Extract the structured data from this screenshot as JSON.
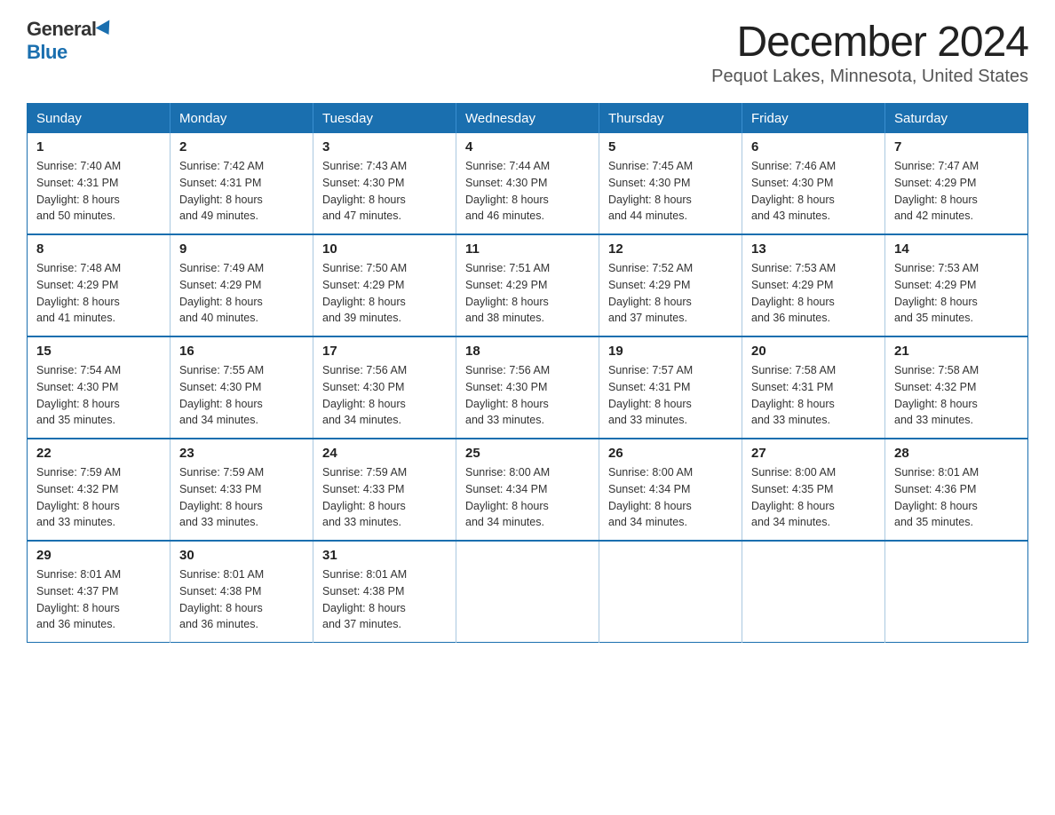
{
  "logo": {
    "general": "General",
    "blue": "Blue"
  },
  "title": "December 2024",
  "subtitle": "Pequot Lakes, Minnesota, United States",
  "days_of_week": [
    "Sunday",
    "Monday",
    "Tuesday",
    "Wednesday",
    "Thursday",
    "Friday",
    "Saturday"
  ],
  "weeks": [
    [
      {
        "day": "1",
        "sunrise": "7:40 AM",
        "sunset": "4:31 PM",
        "daylight": "8 hours and 50 minutes."
      },
      {
        "day": "2",
        "sunrise": "7:42 AM",
        "sunset": "4:31 PM",
        "daylight": "8 hours and 49 minutes."
      },
      {
        "day": "3",
        "sunrise": "7:43 AM",
        "sunset": "4:30 PM",
        "daylight": "8 hours and 47 minutes."
      },
      {
        "day": "4",
        "sunrise": "7:44 AM",
        "sunset": "4:30 PM",
        "daylight": "8 hours and 46 minutes."
      },
      {
        "day": "5",
        "sunrise": "7:45 AM",
        "sunset": "4:30 PM",
        "daylight": "8 hours and 44 minutes."
      },
      {
        "day": "6",
        "sunrise": "7:46 AM",
        "sunset": "4:30 PM",
        "daylight": "8 hours and 43 minutes."
      },
      {
        "day": "7",
        "sunrise": "7:47 AM",
        "sunset": "4:29 PM",
        "daylight": "8 hours and 42 minutes."
      }
    ],
    [
      {
        "day": "8",
        "sunrise": "7:48 AM",
        "sunset": "4:29 PM",
        "daylight": "8 hours and 41 minutes."
      },
      {
        "day": "9",
        "sunrise": "7:49 AM",
        "sunset": "4:29 PM",
        "daylight": "8 hours and 40 minutes."
      },
      {
        "day": "10",
        "sunrise": "7:50 AM",
        "sunset": "4:29 PM",
        "daylight": "8 hours and 39 minutes."
      },
      {
        "day": "11",
        "sunrise": "7:51 AM",
        "sunset": "4:29 PM",
        "daylight": "8 hours and 38 minutes."
      },
      {
        "day": "12",
        "sunrise": "7:52 AM",
        "sunset": "4:29 PM",
        "daylight": "8 hours and 37 minutes."
      },
      {
        "day": "13",
        "sunrise": "7:53 AM",
        "sunset": "4:29 PM",
        "daylight": "8 hours and 36 minutes."
      },
      {
        "day": "14",
        "sunrise": "7:53 AM",
        "sunset": "4:29 PM",
        "daylight": "8 hours and 35 minutes."
      }
    ],
    [
      {
        "day": "15",
        "sunrise": "7:54 AM",
        "sunset": "4:30 PM",
        "daylight": "8 hours and 35 minutes."
      },
      {
        "day": "16",
        "sunrise": "7:55 AM",
        "sunset": "4:30 PM",
        "daylight": "8 hours and 34 minutes."
      },
      {
        "day": "17",
        "sunrise": "7:56 AM",
        "sunset": "4:30 PM",
        "daylight": "8 hours and 34 minutes."
      },
      {
        "day": "18",
        "sunrise": "7:56 AM",
        "sunset": "4:30 PM",
        "daylight": "8 hours and 33 minutes."
      },
      {
        "day": "19",
        "sunrise": "7:57 AM",
        "sunset": "4:31 PM",
        "daylight": "8 hours and 33 minutes."
      },
      {
        "day": "20",
        "sunrise": "7:58 AM",
        "sunset": "4:31 PM",
        "daylight": "8 hours and 33 minutes."
      },
      {
        "day": "21",
        "sunrise": "7:58 AM",
        "sunset": "4:32 PM",
        "daylight": "8 hours and 33 minutes."
      }
    ],
    [
      {
        "day": "22",
        "sunrise": "7:59 AM",
        "sunset": "4:32 PM",
        "daylight": "8 hours and 33 minutes."
      },
      {
        "day": "23",
        "sunrise": "7:59 AM",
        "sunset": "4:33 PM",
        "daylight": "8 hours and 33 minutes."
      },
      {
        "day": "24",
        "sunrise": "7:59 AM",
        "sunset": "4:33 PM",
        "daylight": "8 hours and 33 minutes."
      },
      {
        "day": "25",
        "sunrise": "8:00 AM",
        "sunset": "4:34 PM",
        "daylight": "8 hours and 34 minutes."
      },
      {
        "day": "26",
        "sunrise": "8:00 AM",
        "sunset": "4:34 PM",
        "daylight": "8 hours and 34 minutes."
      },
      {
        "day": "27",
        "sunrise": "8:00 AM",
        "sunset": "4:35 PM",
        "daylight": "8 hours and 34 minutes."
      },
      {
        "day": "28",
        "sunrise": "8:01 AM",
        "sunset": "4:36 PM",
        "daylight": "8 hours and 35 minutes."
      }
    ],
    [
      {
        "day": "29",
        "sunrise": "8:01 AM",
        "sunset": "4:37 PM",
        "daylight": "8 hours and 36 minutes."
      },
      {
        "day": "30",
        "sunrise": "8:01 AM",
        "sunset": "4:38 PM",
        "daylight": "8 hours and 36 minutes."
      },
      {
        "day": "31",
        "sunrise": "8:01 AM",
        "sunset": "4:38 PM",
        "daylight": "8 hours and 37 minutes."
      },
      null,
      null,
      null,
      null
    ]
  ],
  "labels": {
    "sunrise": "Sunrise:",
    "sunset": "Sunset:",
    "daylight": "Daylight:"
  }
}
